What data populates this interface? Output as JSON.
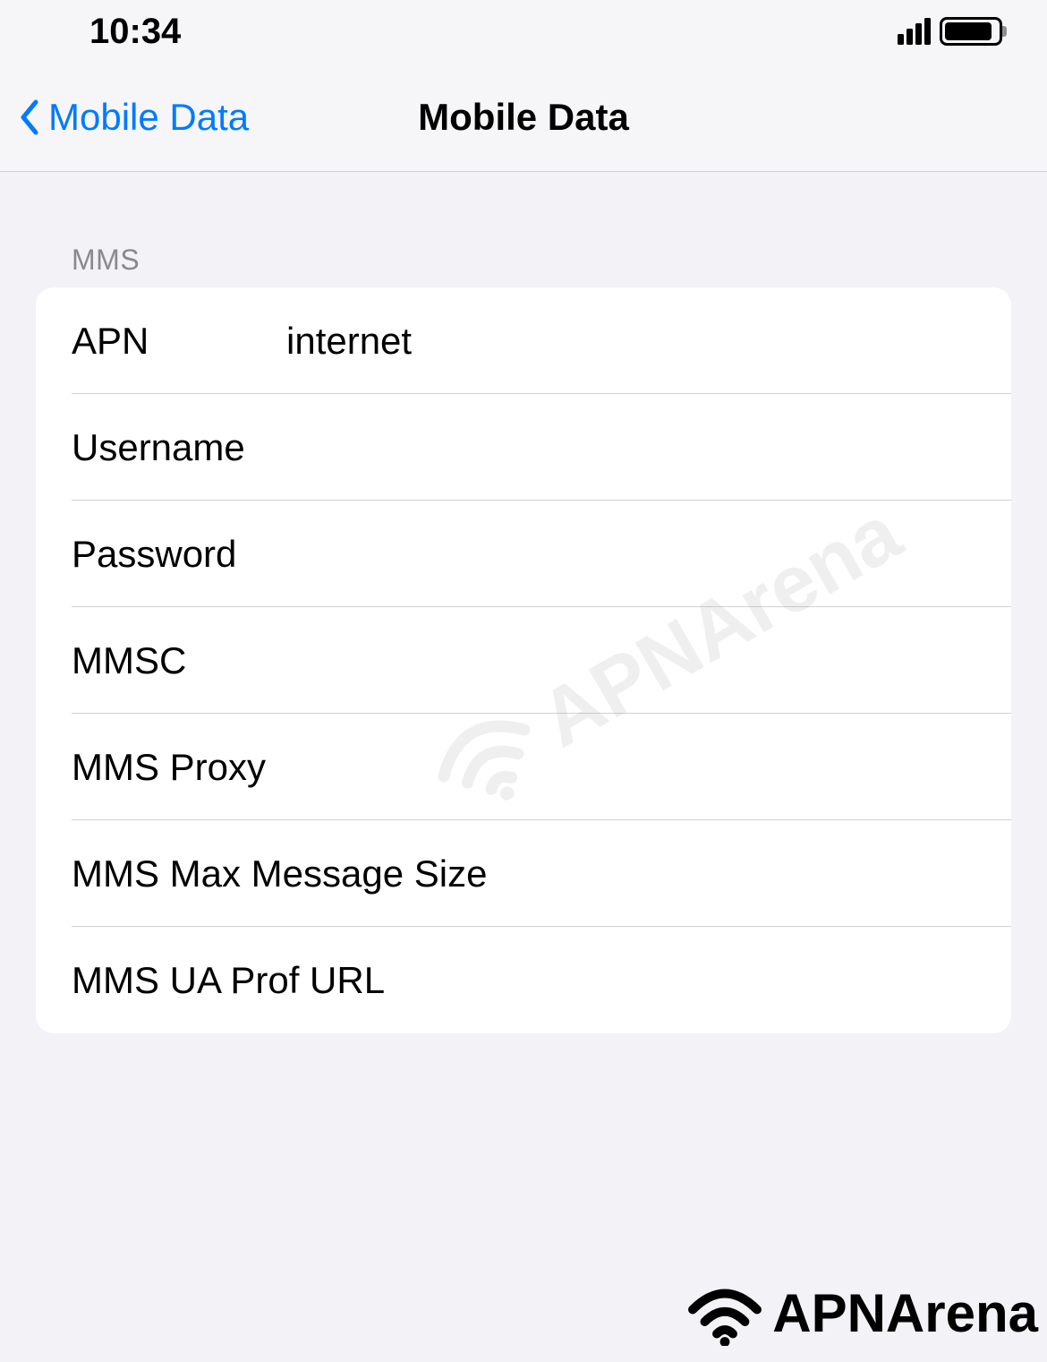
{
  "status_bar": {
    "time": "10:34"
  },
  "nav": {
    "back_label": "Mobile Data",
    "title": "Mobile Data"
  },
  "section": {
    "header": "MMS",
    "rows": [
      {
        "label": "APN",
        "value": "internet"
      },
      {
        "label": "Username",
        "value": ""
      },
      {
        "label": "Password",
        "value": ""
      },
      {
        "label": "MMSC",
        "value": ""
      },
      {
        "label": "MMS Proxy",
        "value": ""
      },
      {
        "label": "MMS Max Message Size",
        "value": ""
      },
      {
        "label": "MMS UA Prof URL",
        "value": ""
      }
    ]
  },
  "watermark": "APNArena"
}
